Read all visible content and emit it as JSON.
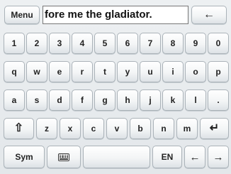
{
  "top_row": {
    "menu_label": "Menu",
    "input_value": "fore me the gladiator.",
    "backspace_icon": "left-arrow-icon",
    "backspace_glyph": "←"
  },
  "number_row": [
    "1",
    "2",
    "3",
    "4",
    "5",
    "6",
    "7",
    "8",
    "9",
    "0"
  ],
  "row_q": [
    "q",
    "w",
    "e",
    "r",
    "t",
    "y",
    "u",
    "i",
    "o",
    "p"
  ],
  "row_a": [
    "a",
    "s",
    "d",
    "f",
    "g",
    "h",
    "j",
    "k",
    "l",
    "."
  ],
  "row_z": {
    "shift_glyph": "⇧",
    "shift_icon": "shift-icon",
    "letters": [
      "z",
      "x",
      "c",
      "v",
      "b",
      "n",
      "m"
    ],
    "enter_glyph": "↵",
    "enter_icon": "enter-icon"
  },
  "bottom_row": {
    "sym_label": "Sym",
    "keyboard_icon": "keyboard-icon",
    "lang_label": "EN",
    "left_glyph": "←",
    "right_glyph": "→"
  }
}
